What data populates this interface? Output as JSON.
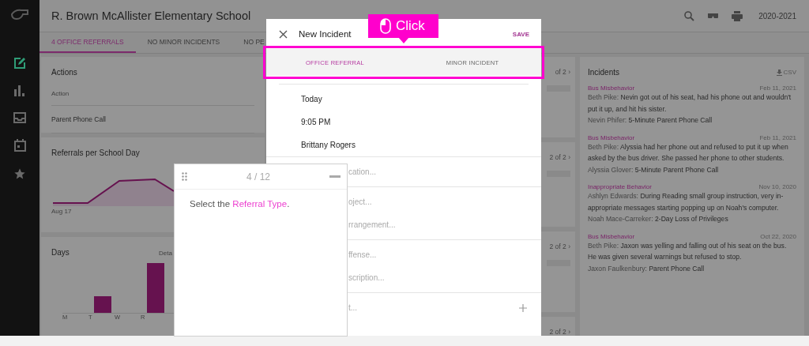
{
  "header": {
    "title": "R. Brown McAllister Elementary School",
    "year": "2020-2021"
  },
  "tabs": [
    {
      "label": "4 OFFICE REFERRALS",
      "selected": true
    },
    {
      "label": "NO MINOR INCIDENTS",
      "selected": false
    },
    {
      "label": "NO PE",
      "selected": false
    }
  ],
  "actions": {
    "title": "Actions",
    "column": "Action",
    "rows": [
      "Parent Phone Call"
    ]
  },
  "referrals": {
    "title": "Referrals per School Day",
    "x_label": "Aug 17"
  },
  "days": {
    "title": "Days",
    "link": "Deta",
    "labels": [
      "M",
      "T",
      "W",
      "R"
    ]
  },
  "middle_pagers": [
    "of 2 ›",
    "2 of 2 ›",
    "2 of 2 ›",
    "2 of 2 ›"
  ],
  "incidents": {
    "title": "Incidents",
    "export": "CSV",
    "items": [
      {
        "type": "Bus Misbehavior",
        "date": "Feb 11, 2021",
        "reporter": "Beth Pike:",
        "description": "Nevin got out of his seat, had his phone out and wouldn't put it up, and hit his sister.",
        "student": "Nevin Phifer:",
        "action": "5-Minute Parent Phone Call"
      },
      {
        "type": "Bus Misbehavior",
        "date": "Feb 11, 2021",
        "reporter": "Beth Pike:",
        "description": "Alyssia had her phone out and refused to put it up when asked by the bus driver. She passed her phone to other students.",
        "student": "Alyssia Glover:",
        "action": "5-Minute Parent Phone Call"
      },
      {
        "type": "Inappropriate Behavior",
        "date": "Nov 10, 2020",
        "reporter": "Ashlyn Edwards:",
        "description": "During Reading small group instruction, very in-appropriate messages starting popping up on Noah's computer.",
        "student": "Noah Mace-Carreker:",
        "action": "2-Day Loss of Privileges"
      },
      {
        "type": "Bus Misbehavior",
        "date": "Oct 22, 2020",
        "reporter": "Beth Pike:",
        "description": "Jaxon was yelling and falling out of his seat on the bus. He was given several warnings but refused to stop.",
        "student": "Jaxon Faulkenbury:",
        "action": "Parent Phone Call"
      }
    ]
  },
  "modal": {
    "title": "New Incident",
    "save": "SAVE",
    "tabs": [
      {
        "label": "OFFICE REFERRAL",
        "selected": true
      },
      {
        "label": "MINOR INCIDENT",
        "selected": false
      }
    ],
    "groups": [
      [
        {
          "kind": "value",
          "text": "Today"
        },
        {
          "kind": "value",
          "text": "9:05 PM"
        },
        {
          "kind": "value",
          "text": "Brittany Rogers"
        }
      ],
      [
        {
          "kind": "placeholder",
          "text": "cation..."
        }
      ],
      [
        {
          "kind": "placeholder",
          "text": "oject..."
        },
        {
          "kind": "placeholder",
          "text": "rrangement..."
        }
      ],
      [
        {
          "kind": "placeholder",
          "text": "ffense..."
        },
        {
          "kind": "placeholder",
          "text": "scription..."
        }
      ],
      [
        {
          "kind": "add",
          "text": "t..."
        }
      ]
    ]
  },
  "callout": {
    "label": "Click"
  },
  "guide": {
    "step": "4 / 12",
    "text_before": "Select the ",
    "highlight": "Referral Type",
    "text_after": "."
  }
}
